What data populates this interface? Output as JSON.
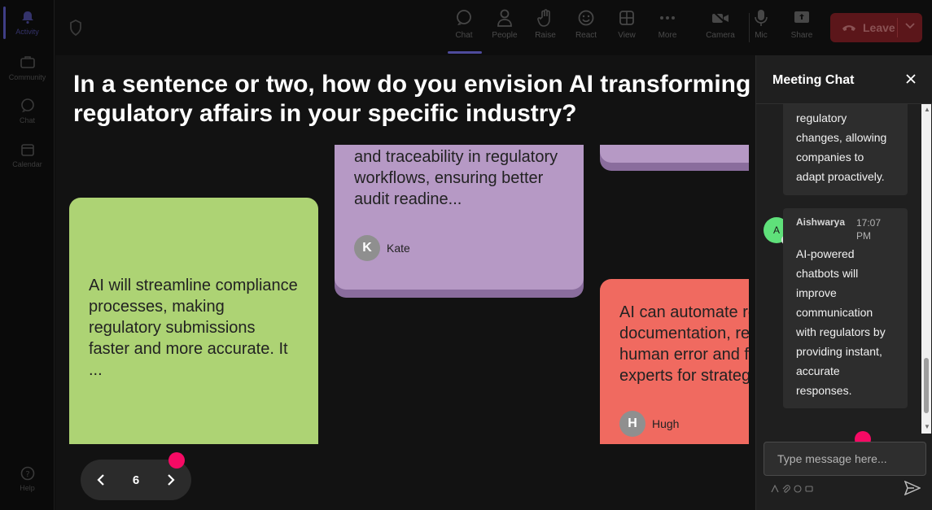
{
  "rail": {
    "items": [
      {
        "label": "Activity",
        "icon": "bell-icon"
      },
      {
        "label": "Community",
        "icon": "community-icon"
      },
      {
        "label": "Chat",
        "icon": "chat-icon"
      },
      {
        "label": "Calendar",
        "icon": "calendar-icon"
      }
    ],
    "help_label": "Help"
  },
  "toolbar": {
    "items": [
      {
        "label": "Chat",
        "icon": "chat-icon"
      },
      {
        "label": "People",
        "icon": "people-icon"
      },
      {
        "label": "Raise",
        "icon": "raise-hand-icon"
      },
      {
        "label": "React",
        "icon": "react-icon"
      },
      {
        "label": "View",
        "icon": "view-grid-icon"
      },
      {
        "label": "More",
        "icon": "more-icon"
      },
      {
        "label": "Camera",
        "icon": "camera-off-icon"
      },
      {
        "label": "Mic",
        "icon": "mic-icon"
      },
      {
        "label": "Share",
        "icon": "share-icon"
      }
    ],
    "leave_label": "Leave"
  },
  "stage": {
    "question": "In a sentence or two, how do you envision AI transforming regulatory affairs in your specific industry?",
    "cards": {
      "purple": {
        "lines": [
          "and traceability in regulatory",
          "workflows, ensuring better",
          "audit readine..."
        ],
        "author_initial": "K",
        "author_name": "Kate"
      },
      "green": {
        "lines": [
          "AI will streamline compliance",
          "processes, making",
          "regulatory submissions",
          "faster and more accurate. It",
          "..."
        ]
      },
      "red": {
        "lines": [
          "AI can automate re",
          "documentation, re",
          "human error and f",
          "experts for strateg"
        ],
        "author_initial": "H",
        "author_name": "Hugh"
      }
    },
    "pager": {
      "page": "6"
    }
  },
  "chat": {
    "title": "Meeting Chat",
    "prev_message_lines": [
      "regulatory",
      "changes, allowing",
      "companies to",
      "adapt proactively."
    ],
    "message": {
      "author": "Aishwarya",
      "time": "17:07 PM",
      "avatar_initial": "A",
      "lines": [
        "AI-powered",
        "chatbots will",
        "improve",
        "communication",
        "with regulators by",
        "providing instant,",
        "accurate",
        "responses."
      ]
    },
    "input_placeholder": "Type message here..."
  },
  "colors": {
    "card_purple": "#b699c5",
    "card_green": "#add374",
    "card_red": "#f06a60",
    "accent_dot": "#f50a64",
    "leave_red": "#c4262e"
  }
}
